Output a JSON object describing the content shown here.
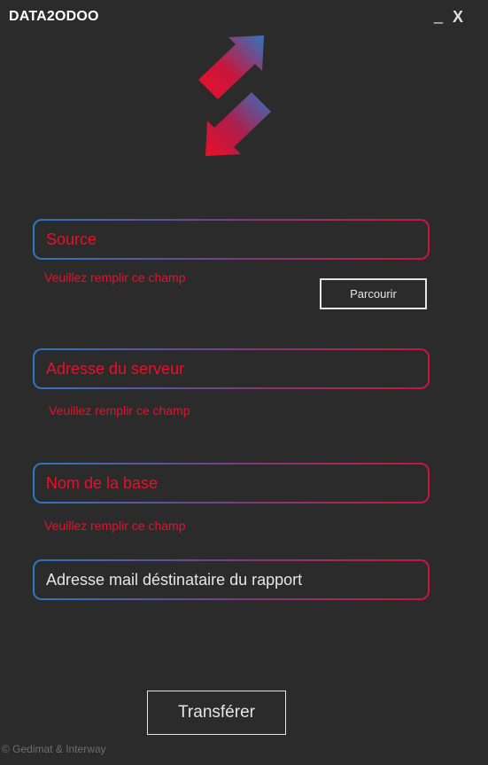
{
  "window": {
    "title": "DATA2ODOO",
    "minimize_glyph": "_",
    "close_glyph": "X"
  },
  "logo": {
    "icon": "swap-arrows-icon",
    "colors": {
      "blue": "#2f76c2",
      "red": "#c8163d"
    }
  },
  "form": {
    "source": {
      "placeholder": "Source",
      "error": "Veuillez remplir ce champ",
      "browse_label": "Parcourir"
    },
    "server": {
      "placeholder": "Adresse du serveur",
      "error": "Veuillez remplir ce champ"
    },
    "database": {
      "placeholder": "Nom de la base",
      "error": "Veuillez remplir ce champ"
    },
    "email": {
      "placeholder": "Adresse mail déstinataire du rapport"
    }
  },
  "actions": {
    "transfer_label": "Transférer"
  },
  "footer": {
    "copyright": "© Gedimat & Interway"
  },
  "colors": {
    "background": "#2b2b2b",
    "accent_blue": "#2f76c2",
    "accent_red": "#e8102a",
    "text": "#e6e6e6"
  }
}
